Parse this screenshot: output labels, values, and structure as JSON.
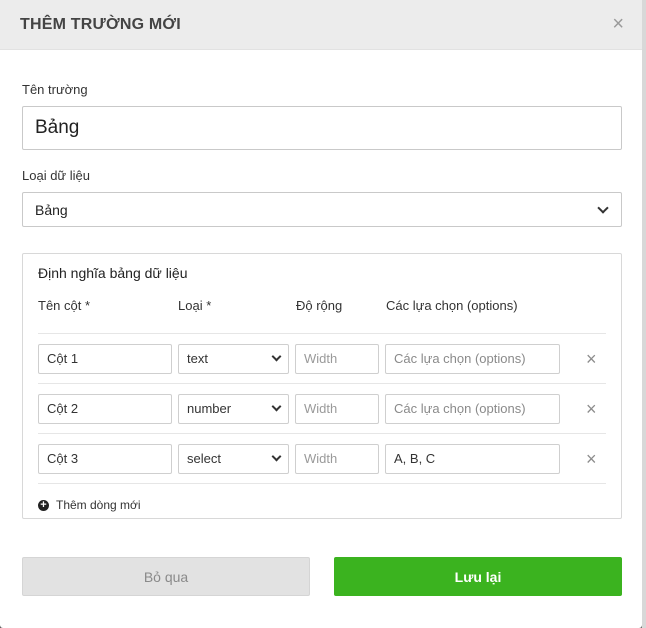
{
  "modal": {
    "title": "THÊM TRƯỜNG MỚI",
    "close_glyph": "×"
  },
  "field_name": {
    "label": "Tên trường",
    "value": "Bảng"
  },
  "data_type": {
    "label": "Loại dữ liệu",
    "selected": "Bảng"
  },
  "table_def": {
    "title": "Định nghĩa bảng dữ liệu",
    "headers": [
      "Tên cột *",
      "Loại *",
      "Độ rộng",
      "Các lựa chọn (options)"
    ],
    "rows": [
      {
        "name": "Cột 1",
        "type": "text",
        "width_placeholder": "Width",
        "options": "Các lựa chọn (options)",
        "options_is_placeholder": true
      },
      {
        "name": "Cột 2",
        "type": "number",
        "width_placeholder": "Width",
        "options": "Các lựa chọn (options)",
        "options_is_placeholder": true
      },
      {
        "name": "Cột 3",
        "type": "select",
        "width_placeholder": "Width",
        "options": "A, B, C",
        "options_is_placeholder": false
      }
    ],
    "remove_glyph": "×",
    "add_row_label": "Thêm dòng mới"
  },
  "buttons": {
    "cancel": "Bỏ qua",
    "save": "Lưu lại"
  },
  "colors": {
    "save_green": "#3bb31f",
    "header_bg": "#ececec"
  }
}
